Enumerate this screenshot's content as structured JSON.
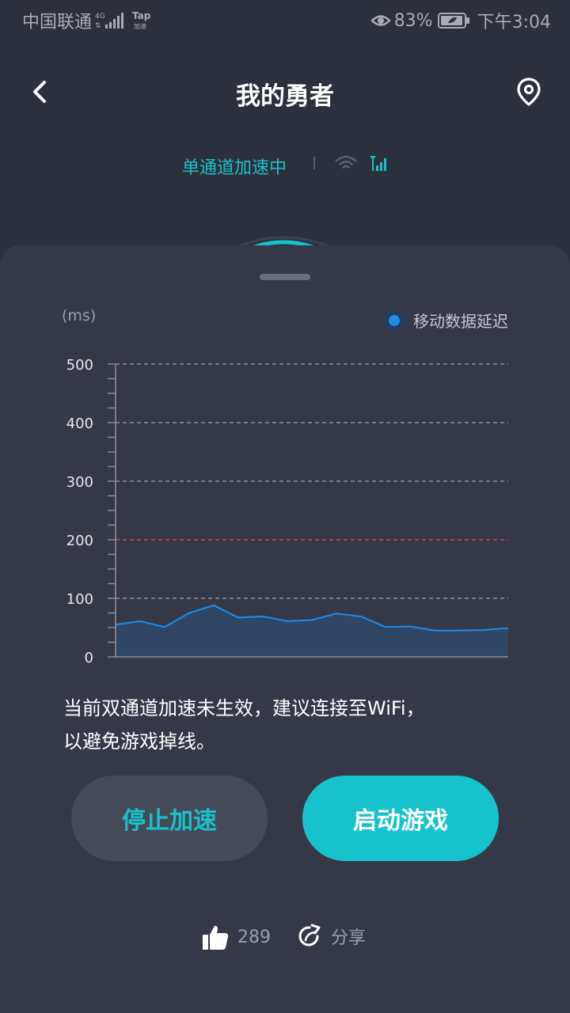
{
  "status_bar": {
    "carrier": "中国联通",
    "network": "4G",
    "app_badge": "Tap",
    "app_badge_sub": "加速",
    "battery": "83%",
    "time": "下午3:04"
  },
  "header": {
    "title": "我的勇者"
  },
  "accel": {
    "status_text": "单通道加速中"
  },
  "chart": {
    "unit_label": "(ms)",
    "legend": "移动数据延迟"
  },
  "chart_data": {
    "type": "area",
    "title": "",
    "ylabel": "(ms)",
    "ylim": [
      0,
      500
    ],
    "yticks": [
      0,
      100,
      200,
      300,
      400,
      500
    ],
    "threshold": 200,
    "grid": true,
    "legend_position": "top-right",
    "series": [
      {
        "name": "移动数据延迟",
        "color": "#1f8bea",
        "values": [
          55,
          61,
          51,
          75,
          88,
          67,
          69,
          61,
          63,
          74,
          69,
          51,
          52,
          45,
          45,
          46,
          49
        ]
      }
    ]
  },
  "notice": {
    "line1": "当前双通道加速未生效，建议连接至WiFi，",
    "line2": "以避免游戏掉线。"
  },
  "buttons": {
    "stop": "停止加速",
    "launch": "启动游戏"
  },
  "footer": {
    "like_count": "289",
    "share_label": "分享"
  },
  "colors": {
    "accent": "#18c1c9",
    "background": "#2c303c",
    "sheet": "#353947",
    "series": "#1f8bea",
    "threshold": "#d9464a"
  }
}
